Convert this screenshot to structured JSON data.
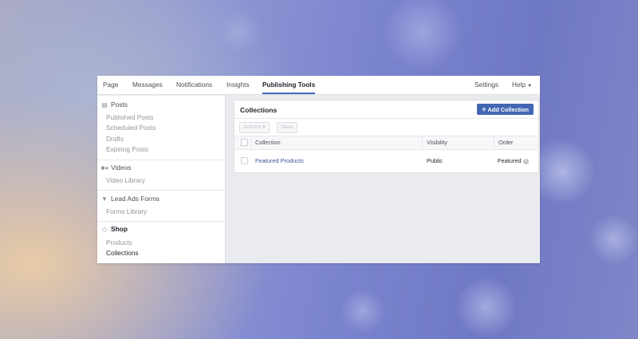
{
  "topnav": {
    "left_tabs": [
      {
        "label": "Page"
      },
      {
        "label": "Messages"
      },
      {
        "label": "Notifications"
      },
      {
        "label": "Insights"
      },
      {
        "label": "Publishing Tools",
        "active": true
      }
    ],
    "settings_label": "Settings",
    "help_label": "Help"
  },
  "sidebar": {
    "sections": [
      {
        "title": "Posts",
        "icon": "posts-icon",
        "items": [
          "Published Posts",
          "Scheduled Posts",
          "Drafts",
          "Expiring Posts"
        ]
      },
      {
        "title": "Videos",
        "icon": "video-camera-icon",
        "items": [
          "Video Library"
        ]
      },
      {
        "title": "Lead Ads Forms",
        "icon": "funnel-icon",
        "items": [
          "Forms Library"
        ]
      },
      {
        "title": "Shop",
        "icon": "tag-icon",
        "items": [
          "Products",
          "Collections"
        ],
        "current_item": "Collections"
      }
    ]
  },
  "collections_panel": {
    "title": "Collections",
    "add_button_label": "Add Collection",
    "actions_label": "Actions",
    "save_label": "Save",
    "columns": [
      "Collection",
      "Visibility",
      "Order"
    ],
    "rows": [
      {
        "collection": "Featured Products",
        "visibility": "Public",
        "order": "Featured"
      }
    ]
  },
  "colors": {
    "accent": "#4267b2",
    "link": "#365899",
    "panel_bg": "#e9ebee"
  }
}
